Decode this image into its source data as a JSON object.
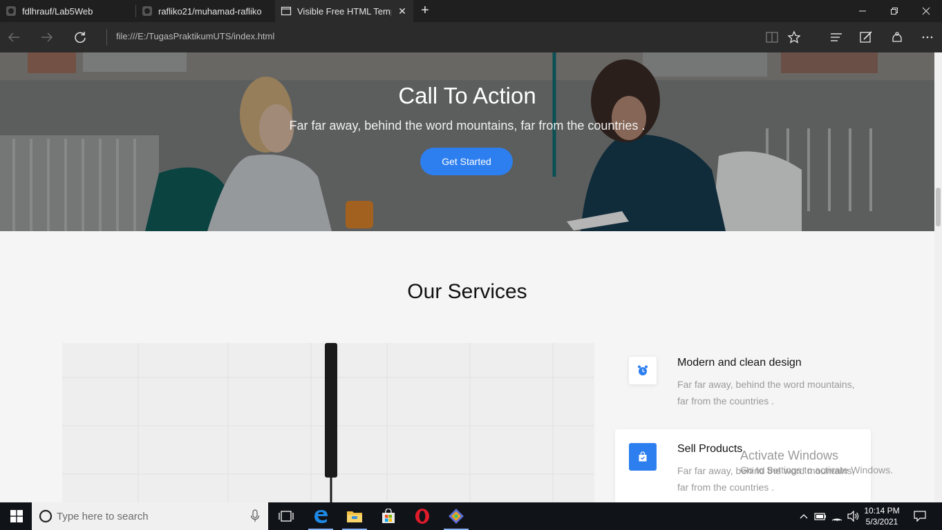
{
  "browser": {
    "tabs": [
      {
        "title": "fdlhrauf/Lab5Web",
        "active": false
      },
      {
        "title": "rafliko21/muhamad-rafliko",
        "active": false
      },
      {
        "title": "Visible Free HTML Temp",
        "active": true
      }
    ],
    "address": "file:///E:/TugasPraktikumUTS/index.html"
  },
  "hero": {
    "title": "Call To Action",
    "subtitle": "Far far away, behind the word mountains, far from the countries .",
    "button_label": "Get Started",
    "accent_color": "#2d7ff0"
  },
  "services": {
    "heading": "Our Services",
    "items": [
      {
        "title": "Modern and clean design",
        "description": "Far far away, behind the word mountains, far from the countries .",
        "icon": "alarm-clock-icon"
      },
      {
        "title": "Sell Products",
        "description": "Far far away, behind the word mountains, far from the countries .",
        "icon": "shopping-bag-icon"
      }
    ]
  },
  "watermark": {
    "line1": "Activate Windows",
    "line2": "Go to Settings to activate Windows."
  },
  "taskbar": {
    "search_placeholder": "Type here to search",
    "time": "10:14 PM",
    "date": "5/3/2021"
  }
}
